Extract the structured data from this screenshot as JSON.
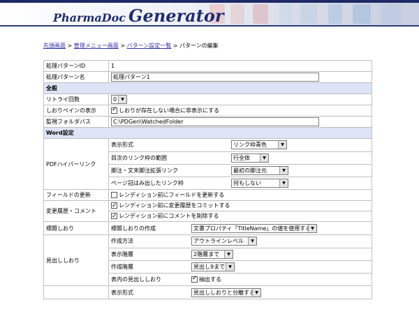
{
  "header": {
    "logo_part1": "PharmaDoc",
    "logo_part2": "Generator"
  },
  "breadcrumb": {
    "items": [
      "先頭画面",
      "管理メニュー画面",
      "パターン設定一覧"
    ],
    "current": "パターンの編集",
    "separator": " > "
  },
  "form": {
    "pattern_id_label": "処理パターンID",
    "pattern_id_value": "1",
    "pattern_name_label": "処理パターン名",
    "pattern_name_value": "処理パターン1",
    "general_section": "全般",
    "retry_label": "リトライ回数",
    "retry_value": "0",
    "bookmark_pane_label": "しおりペインの表示",
    "bookmark_pane_check": "しおりが存在しない場合に非表示にする",
    "watch_folder_label": "監視フォルダパス",
    "watch_folder_value": "C:\\PDGen\\WatchedFolder",
    "word_section": "Word設定",
    "pdf_link_label": "PDFハイパーリンク",
    "pdf_link_rows": [
      {
        "label": "表示形式",
        "value": "リンク枠青色"
      },
      {
        "label": "目次のリンク枠の範囲",
        "value": "行全体"
      },
      {
        "label": "脚注・文末脚注拡張リンク",
        "value": "最初の脚注元"
      },
      {
        "label": "ページ冠はみ出したリンク枠",
        "value": "何もしない"
      }
    ],
    "field_update_label": "フィールドの更新",
    "field_update_check": "レンディション前にフィールドを更新する",
    "history_label": "変更履歴・コメント",
    "history_check_1": "レンディション前に変更履歴をコミットする",
    "history_check_2": "レンディション前にコメントを削除する",
    "bookmark_label": "標題しおり",
    "bookmark_sub_label": "標題しおりの作成",
    "bookmark_sub_value": "文書プロパティ「TitleName」の値を使用する",
    "heading_label": "見出ししおり",
    "heading_rows": [
      {
        "label": "作成方法",
        "value": "アウトラインレベル"
      },
      {
        "label": "表示階層",
        "value": "2階層まで"
      },
      {
        "label": "作成階層",
        "value": "見出し9まで"
      }
    ],
    "heading_table_label": "表内の見出ししおり",
    "heading_table_check": "抽出する",
    "display_format_label": "表示形式",
    "display_format_value": "見出ししおりと分離する"
  }
}
